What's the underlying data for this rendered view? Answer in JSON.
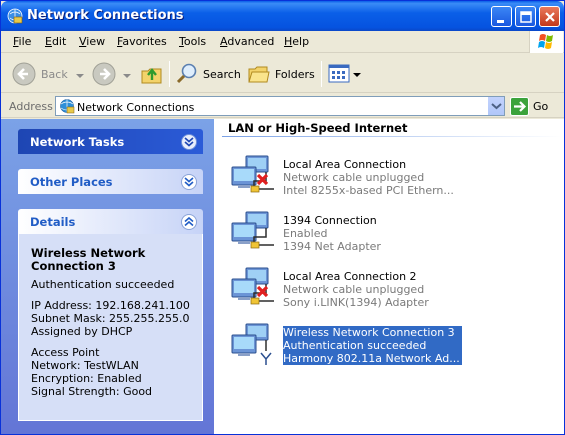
{
  "window": {
    "title": "Network Connections",
    "colors": {
      "titlebar": "#0a5fe8",
      "taskpane": "#6f8fe0",
      "selection": "#316ac5"
    }
  },
  "menu": [
    "File",
    "Edit",
    "View",
    "Favorites",
    "Tools",
    "Advanced",
    "Help"
  ],
  "toolbar": {
    "back_label": "Back",
    "search_label": "Search",
    "folders_label": "Folders"
  },
  "address": {
    "label": "Address",
    "value": "Network Connections",
    "go_label": "Go"
  },
  "taskpane": {
    "network_tasks": "Network Tasks",
    "other_places": "Other Places",
    "details": {
      "heading": "Details",
      "title_line1": "Wireless Network",
      "title_line2": "Connection 3",
      "auth": "Authentication succeeded",
      "ip": "IP Address: 192.168.241.100",
      "mask": "Subnet Mask: 255.255.255.0",
      "assigned": "Assigned by DHCP",
      "ap": "Access Point",
      "network": "Network: TestWLAN",
      "encryption": "Encryption: Enabled",
      "signal": "Signal Strength: Good"
    }
  },
  "content": {
    "group_header": "LAN or High-Speed Internet",
    "connections": [
      {
        "name": "Local Area Connection",
        "status": "Network cable unplugged",
        "adapter": "Intel 8255x-based PCI Ethern...",
        "icon": "lan-unplugged-icon",
        "selected": false
      },
      {
        "name": "1394 Connection",
        "status": "Enabled",
        "adapter": "1394 Net Adapter",
        "icon": "lan-icon",
        "selected": false
      },
      {
        "name": "Local Area Connection 2",
        "status": "Network cable unplugged",
        "adapter": "Sony i.LINK(1394) Adapter",
        "icon": "lan-unplugged-icon",
        "selected": false
      },
      {
        "name": "Wireless Network Connection 3",
        "status": "Authentication succeeded",
        "adapter": "Harmony 802.11a Network Ad...",
        "icon": "wireless-connection-icon",
        "selected": true
      }
    ]
  }
}
